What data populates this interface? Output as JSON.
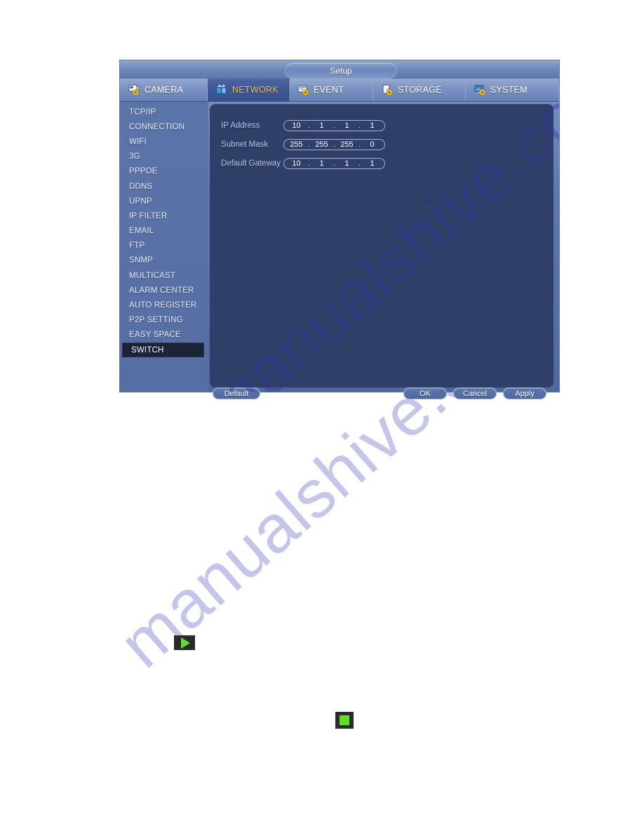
{
  "window": {
    "title": "Setup"
  },
  "tabs": [
    {
      "label": "CAMERA",
      "icon": "camera-gear-icon",
      "active": false
    },
    {
      "label": "NETWORK",
      "icon": "network-gear-icon",
      "active": true
    },
    {
      "label": "EVENT",
      "icon": "event-gear-icon",
      "active": false
    },
    {
      "label": "STORAGE",
      "icon": "storage-gear-icon",
      "active": false
    },
    {
      "label": "SYSTEM",
      "icon": "system-gear-icon",
      "active": false
    }
  ],
  "sidebar": {
    "items": [
      {
        "label": "TCP/IP",
        "selected": false
      },
      {
        "label": "CONNECTION",
        "selected": false
      },
      {
        "label": "WIFI",
        "selected": false
      },
      {
        "label": "3G",
        "selected": false
      },
      {
        "label": "PPPOE",
        "selected": false
      },
      {
        "label": "DDNS",
        "selected": false
      },
      {
        "label": "UPNP",
        "selected": false
      },
      {
        "label": "IP FILTER",
        "selected": false
      },
      {
        "label": "EMAIL",
        "selected": false
      },
      {
        "label": "FTP",
        "selected": false
      },
      {
        "label": "SNMP",
        "selected": false
      },
      {
        "label": "MULTICAST",
        "selected": false
      },
      {
        "label": "ALARM CENTER",
        "selected": false
      },
      {
        "label": "AUTO REGISTER",
        "selected": false
      },
      {
        "label": "P2P SETTING",
        "selected": false
      },
      {
        "label": "EASY SPACE",
        "selected": false
      },
      {
        "label": "SWITCH",
        "selected": true
      }
    ]
  },
  "form": {
    "fields": [
      {
        "label": "IP Address",
        "name": "ip-address",
        "octets": [
          "10",
          "1",
          "1",
          "1"
        ],
        "value": "10.1.1.1"
      },
      {
        "label": "Subnet Mask",
        "name": "subnet-mask",
        "octets": [
          "255",
          "255",
          "255",
          "0"
        ],
        "value": "255.255.255.0"
      },
      {
        "label": "Default Gateway",
        "name": "default-gateway",
        "octets": [
          "10",
          "1",
          "1",
          "1"
        ],
        "value": "10.1.1.1"
      }
    ],
    "separator": "."
  },
  "buttons": {
    "default_label": "Default",
    "ok_label": "OK",
    "cancel_label": "Cancel",
    "apply_label": "Apply"
  },
  "page_glyphs": [
    {
      "name": "play-icon",
      "shape": "triangle-right",
      "color": "#5ce02a",
      "background": "#2b2b2b"
    },
    {
      "name": "stop-icon",
      "shape": "square",
      "color": "#5ce02a",
      "background": "#2b2b2b"
    }
  ],
  "watermark": {
    "text": "manualshive.com",
    "color": "#3c3eaa"
  },
  "colors": {
    "accent_active_tab_text": "#f6c33c",
    "dialog_body": "#5d78ae",
    "content_panel": "#303f67",
    "selected_sidebar": "#1b2336",
    "label_text": "#b9c8ea",
    "green_glyph": "#5ce02a"
  }
}
